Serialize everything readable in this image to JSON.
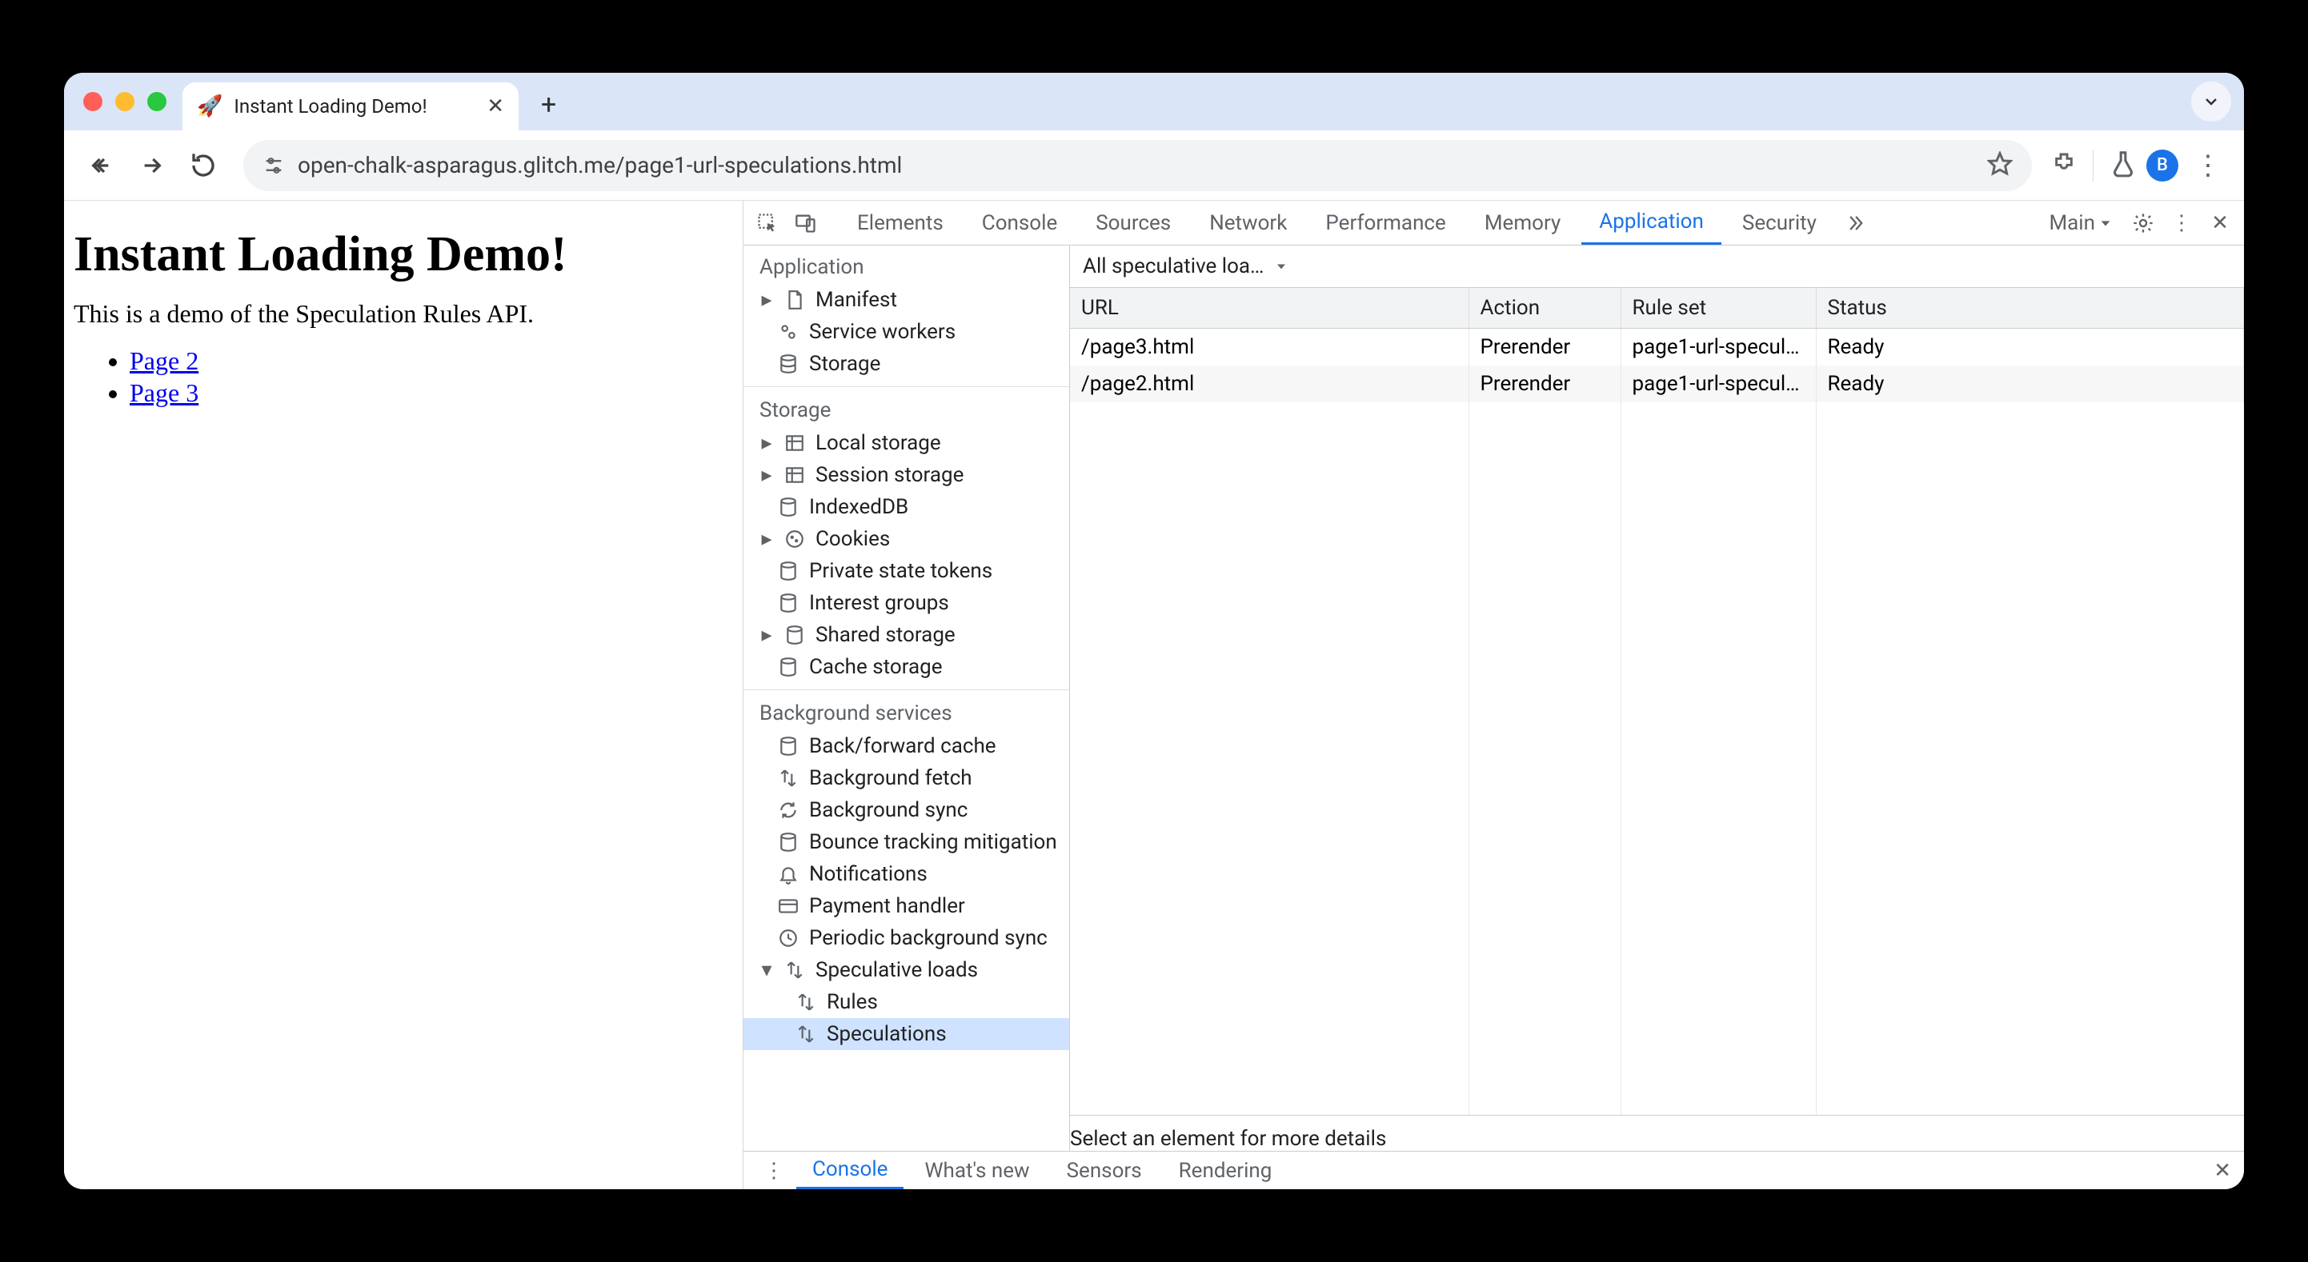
{
  "browser": {
    "tab": {
      "favicon": "🚀",
      "title": "Instant Loading Demo!"
    },
    "url": "open-chalk-asparagus.glitch.me/page1-url-speculations.html",
    "avatar_letter": "B"
  },
  "page": {
    "heading": "Instant Loading Demo!",
    "description": "This is a demo of the Speculation Rules API.",
    "links": [
      {
        "label": "Page 2"
      },
      {
        "label": "Page 3"
      }
    ]
  },
  "devtools": {
    "tabs": [
      "Elements",
      "Console",
      "Sources",
      "Network",
      "Performance",
      "Memory",
      "Application",
      "Security"
    ],
    "active_tab": "Application",
    "frame_selector": "Main",
    "sidebar": {
      "application": {
        "title": "Application",
        "items": [
          "Manifest",
          "Service workers",
          "Storage"
        ]
      },
      "storage": {
        "title": "Storage",
        "items": [
          "Local storage",
          "Session storage",
          "IndexedDB",
          "Cookies",
          "Private state tokens",
          "Interest groups",
          "Shared storage",
          "Cache storage"
        ]
      },
      "background_services": {
        "title": "Background services",
        "items": [
          "Back/forward cache",
          "Background fetch",
          "Background sync",
          "Bounce tracking mitigation",
          "Notifications",
          "Payment handler",
          "Periodic background sync"
        ],
        "speculative": {
          "label": "Speculative loads",
          "children": [
            "Rules",
            "Speculations"
          ],
          "selected": "Speculations"
        }
      }
    },
    "panel": {
      "filter_label": "All speculative loa…",
      "columns": [
        "URL",
        "Action",
        "Rule set",
        "Status"
      ],
      "rows": [
        {
          "url": "/page3.html",
          "action": "Prerender",
          "ruleset": "page1-url-specul…",
          "status": "Ready"
        },
        {
          "url": "/page2.html",
          "action": "Prerender",
          "ruleset": "page1-url-specul…",
          "status": "Ready"
        }
      ],
      "detail_placeholder": "Select an element for more details"
    },
    "drawer": {
      "tabs": [
        "Console",
        "What's new",
        "Sensors",
        "Rendering"
      ],
      "active": "Console"
    }
  }
}
